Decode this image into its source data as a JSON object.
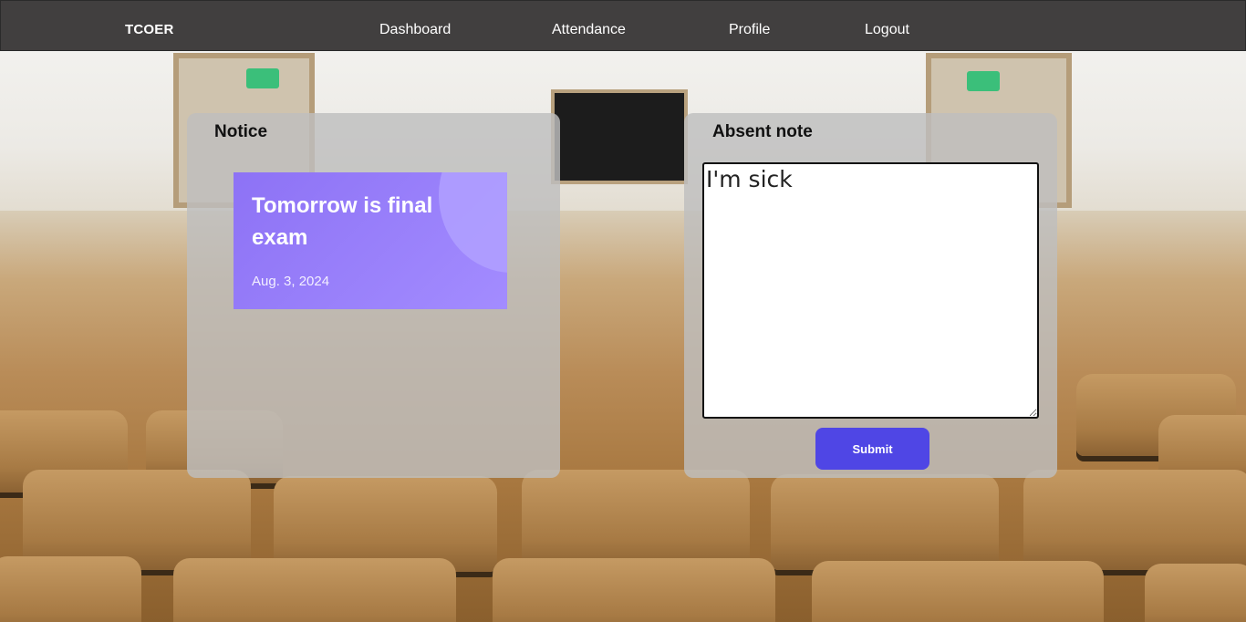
{
  "nav": {
    "brand": "TCOER",
    "links": [
      "Dashboard",
      "Attendance",
      "Profile",
      "Logout"
    ]
  },
  "notice": {
    "heading": "Notice",
    "card": {
      "title": "Tomorrow is final exam",
      "date": "Aug. 3, 2024"
    }
  },
  "absent": {
    "heading": "Absent note",
    "note_value": "I'm sick",
    "submit_label": "Submit"
  },
  "colors": {
    "nav_bg": "#413f3f",
    "card_accent": "#8d72f5",
    "submit_bg": "#4f46e5"
  }
}
